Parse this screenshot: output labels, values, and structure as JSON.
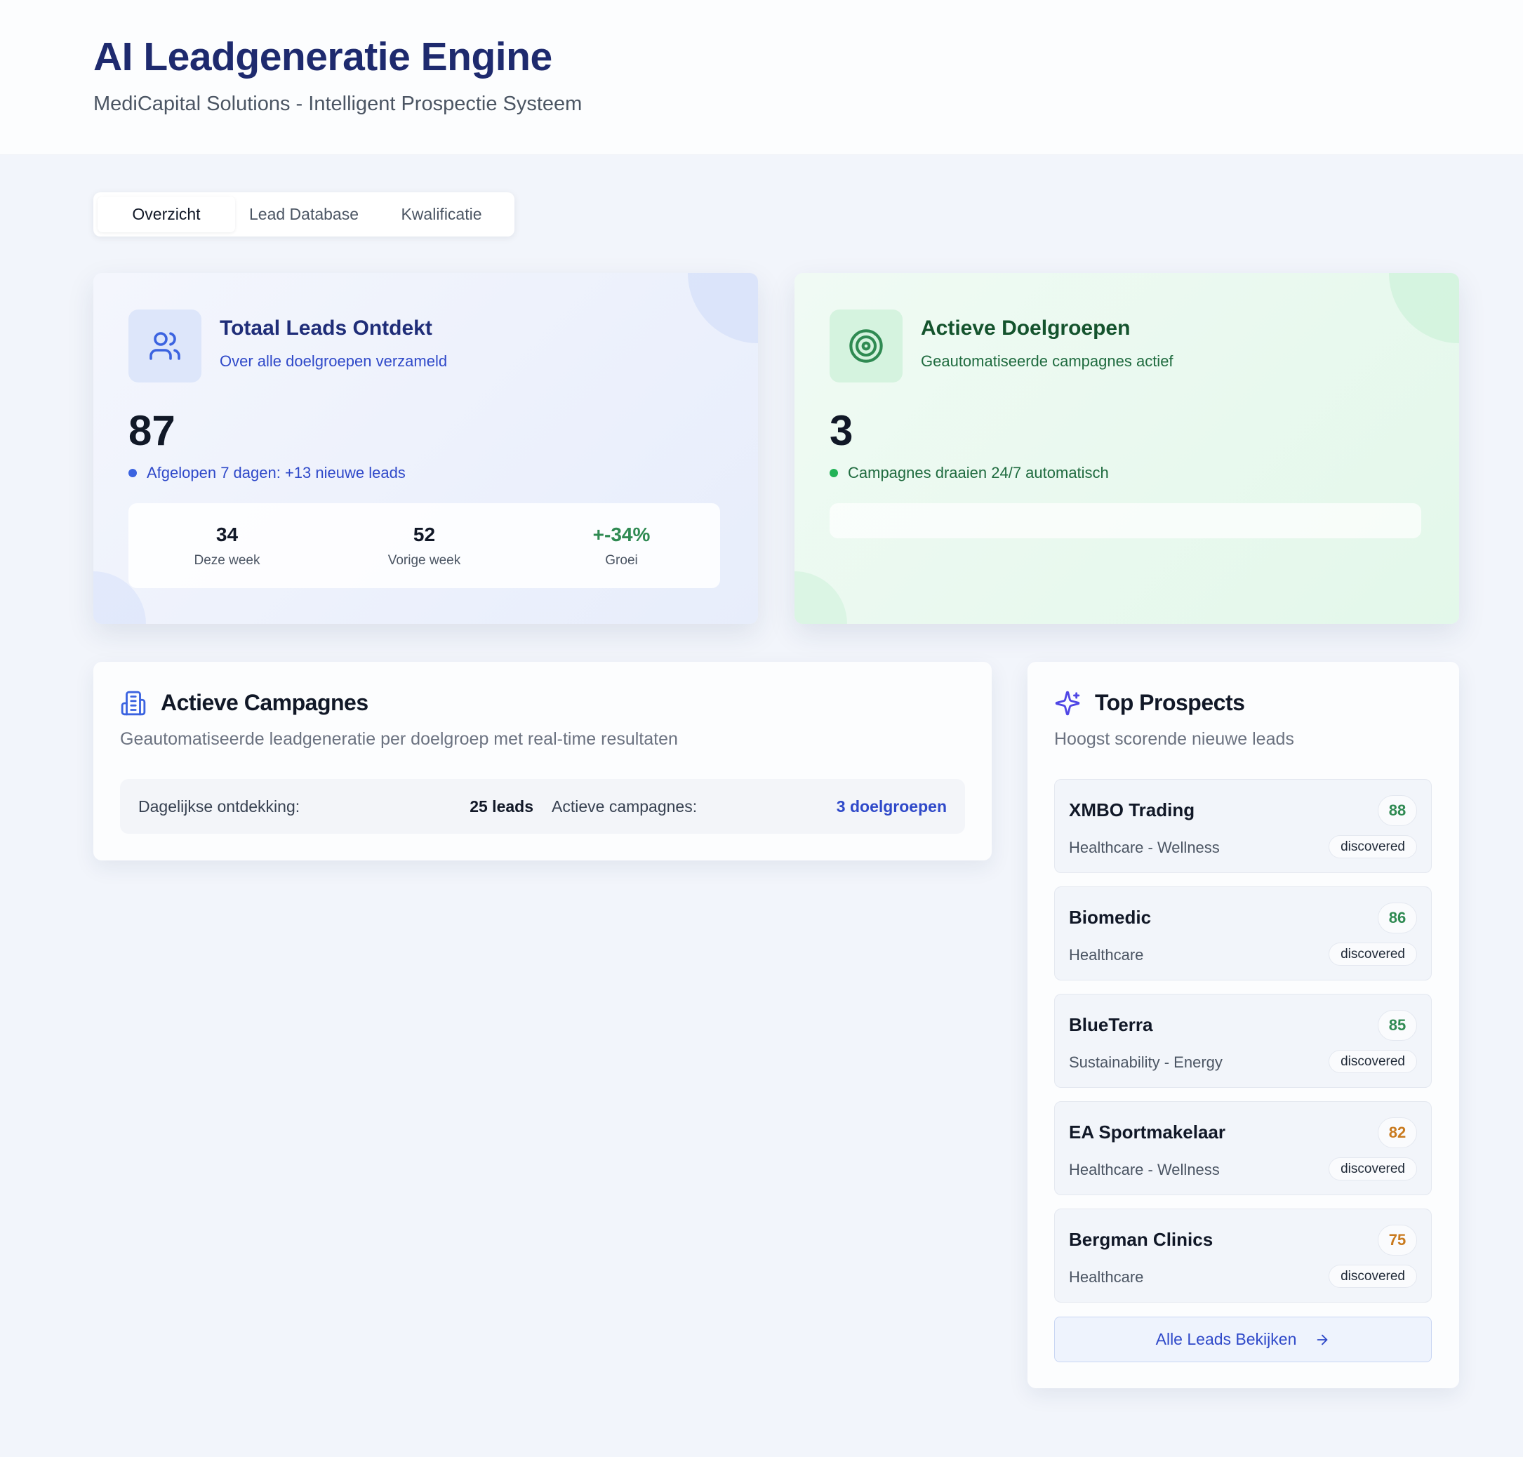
{
  "header": {
    "title": "AI Leadgeneratie Engine",
    "subtitle": "MediCapital Solutions - Intelligent Prospectie Systeem"
  },
  "tabs": [
    {
      "label": "Overzicht",
      "active": true
    },
    {
      "label": "Lead Database",
      "active": false
    },
    {
      "label": "Kwalificatie",
      "active": false
    }
  ],
  "leads_card": {
    "icon": "users-icon",
    "title": "Totaal Leads Ontdekt",
    "description": "Over alle doelgroepen verzameld",
    "value": "87",
    "note": "Afgelopen 7 dagen: +13 nieuwe leads",
    "stats": [
      {
        "value": "34",
        "label": "Deze week"
      },
      {
        "value": "52",
        "label": "Vorige week"
      },
      {
        "value": "+-34%",
        "label": "Groei"
      }
    ]
  },
  "audience_card": {
    "icon": "target-icon",
    "title": "Actieve Doelgroepen",
    "description": "Geautomatiseerde campagnes actief",
    "value": "3",
    "note": "Campagnes draaien 24/7 automatisch"
  },
  "campaigns": {
    "icon": "building-icon",
    "title": "Actieve Campagnes",
    "description": "Geautomatiseerde leadgeneratie per doelgroep met real-time resultaten",
    "daily_label": "Dagelijkse ontdekking:",
    "daily_value": "25 leads",
    "active_label": "Actieve campagnes:",
    "active_value": "3 doelgroepen"
  },
  "prospects": {
    "icon": "sparkles-icon",
    "title": "Top Prospects",
    "description": "Hoogst scorende nieuwe leads",
    "items": [
      {
        "name": "XMBO Trading",
        "sector": "Healthcare - Wellness",
        "score": "88",
        "status": "discovered"
      },
      {
        "name": "Biomedic",
        "sector": "Healthcare",
        "score": "86",
        "status": "discovered"
      },
      {
        "name": "BlueTerra",
        "sector": "Sustainability - Energy",
        "score": "85",
        "status": "discovered"
      },
      {
        "name": "EA Sportmakelaar",
        "sector": "Healthcare - Wellness",
        "score": "82",
        "status": "discovered"
      },
      {
        "name": "Bergman Clinics",
        "sector": "Healthcare",
        "score": "75",
        "status": "discovered"
      }
    ],
    "button_label": "Alle Leads Bekijken"
  },
  "colors": {
    "title": "#1e2a6e",
    "accent_blue": "#2f49c9",
    "accent_green": "#2f8a52",
    "score_mid": "#c97a1e"
  }
}
